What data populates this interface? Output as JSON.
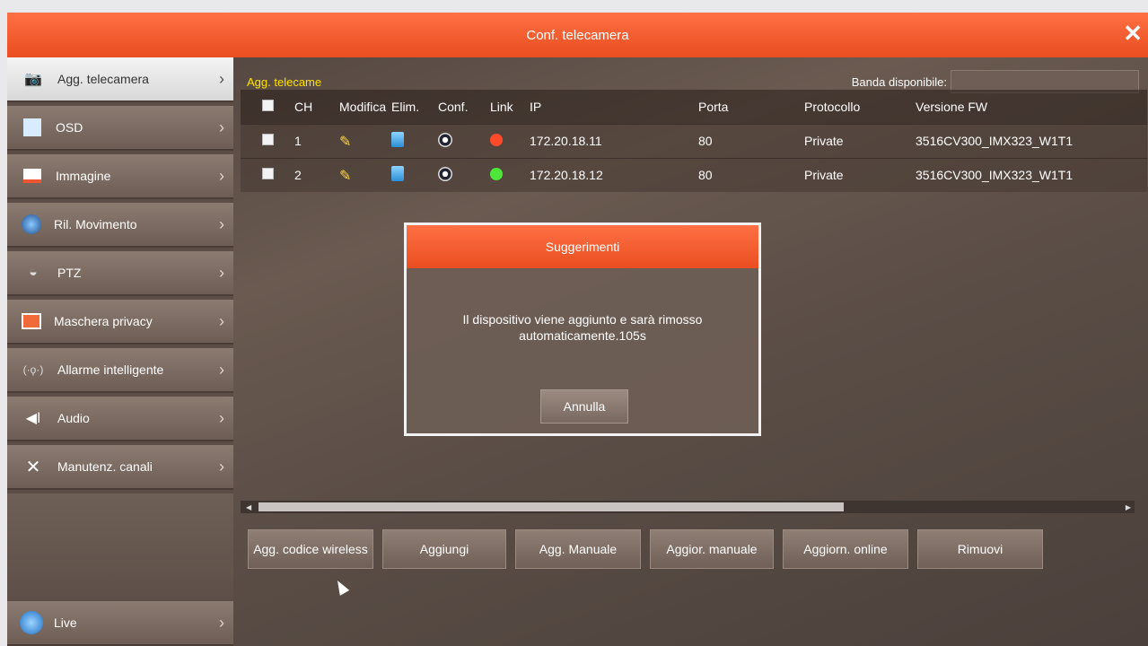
{
  "window": {
    "title": "Conf. telecamera",
    "close_icon": "close-icon"
  },
  "sidebar": {
    "items": [
      {
        "label": "Agg. telecamera",
        "icon": "camera-icon",
        "active": true
      },
      {
        "label": "OSD",
        "icon": "osd-icon",
        "active": false
      },
      {
        "label": "Immagine",
        "icon": "image-icon",
        "active": false
      },
      {
        "label": "Ril. Movimento",
        "icon": "motion-icon",
        "active": false
      },
      {
        "label": "PTZ",
        "icon": "ptz-icon",
        "active": false
      },
      {
        "label": "Maschera privacy",
        "icon": "privacy-mask-icon",
        "active": false
      },
      {
        "label": "Allarme intelligente",
        "icon": "smart-alarm-icon",
        "active": false
      },
      {
        "label": "Audio",
        "icon": "audio-icon",
        "active": false
      },
      {
        "label": "Manutenz. canali",
        "icon": "tools-icon",
        "active": false
      }
    ],
    "live": {
      "label": "Live",
      "icon": "live-icon"
    }
  },
  "main": {
    "section_label": "Agg. telecame",
    "bandwidth_label": "Banda disponibile:",
    "bandwidth_value": ""
  },
  "table": {
    "headers": [
      "CH",
      "Modifica",
      "Elim.",
      "Conf.",
      "Link",
      "IP",
      "Porta",
      "Protocollo",
      "Versione FW"
    ],
    "rows": [
      {
        "ch": "1",
        "ip": "172.20.18.11",
        "porta": "80",
        "protocollo": "Private",
        "fw": "3516CV300_IMX323_W1T1",
        "link_color": "#ff4b2b"
      },
      {
        "ch": "2",
        "ip": "172.20.18.12",
        "porta": "80",
        "protocollo": "Private",
        "fw": "3516CV300_IMX323_W1T1",
        "link_color": "#4fe63a"
      }
    ]
  },
  "buttons": {
    "wireless": "Agg. codice wireless",
    "add": "Aggiungi",
    "manual_add": "Agg. Manuale",
    "manual_update": "Aggior. manuale",
    "online_update": "Aggiorn. online",
    "remove": "Rimuovi"
  },
  "dialog": {
    "title": "Suggerimenti",
    "message_line1": "Il dispositivo viene aggiunto e sarà rimosso",
    "message_line2": "automaticamente.105s",
    "cancel": "Annulla"
  },
  "colors": {
    "accent": "#e94e20",
    "label_yellow": "#ffe200"
  }
}
